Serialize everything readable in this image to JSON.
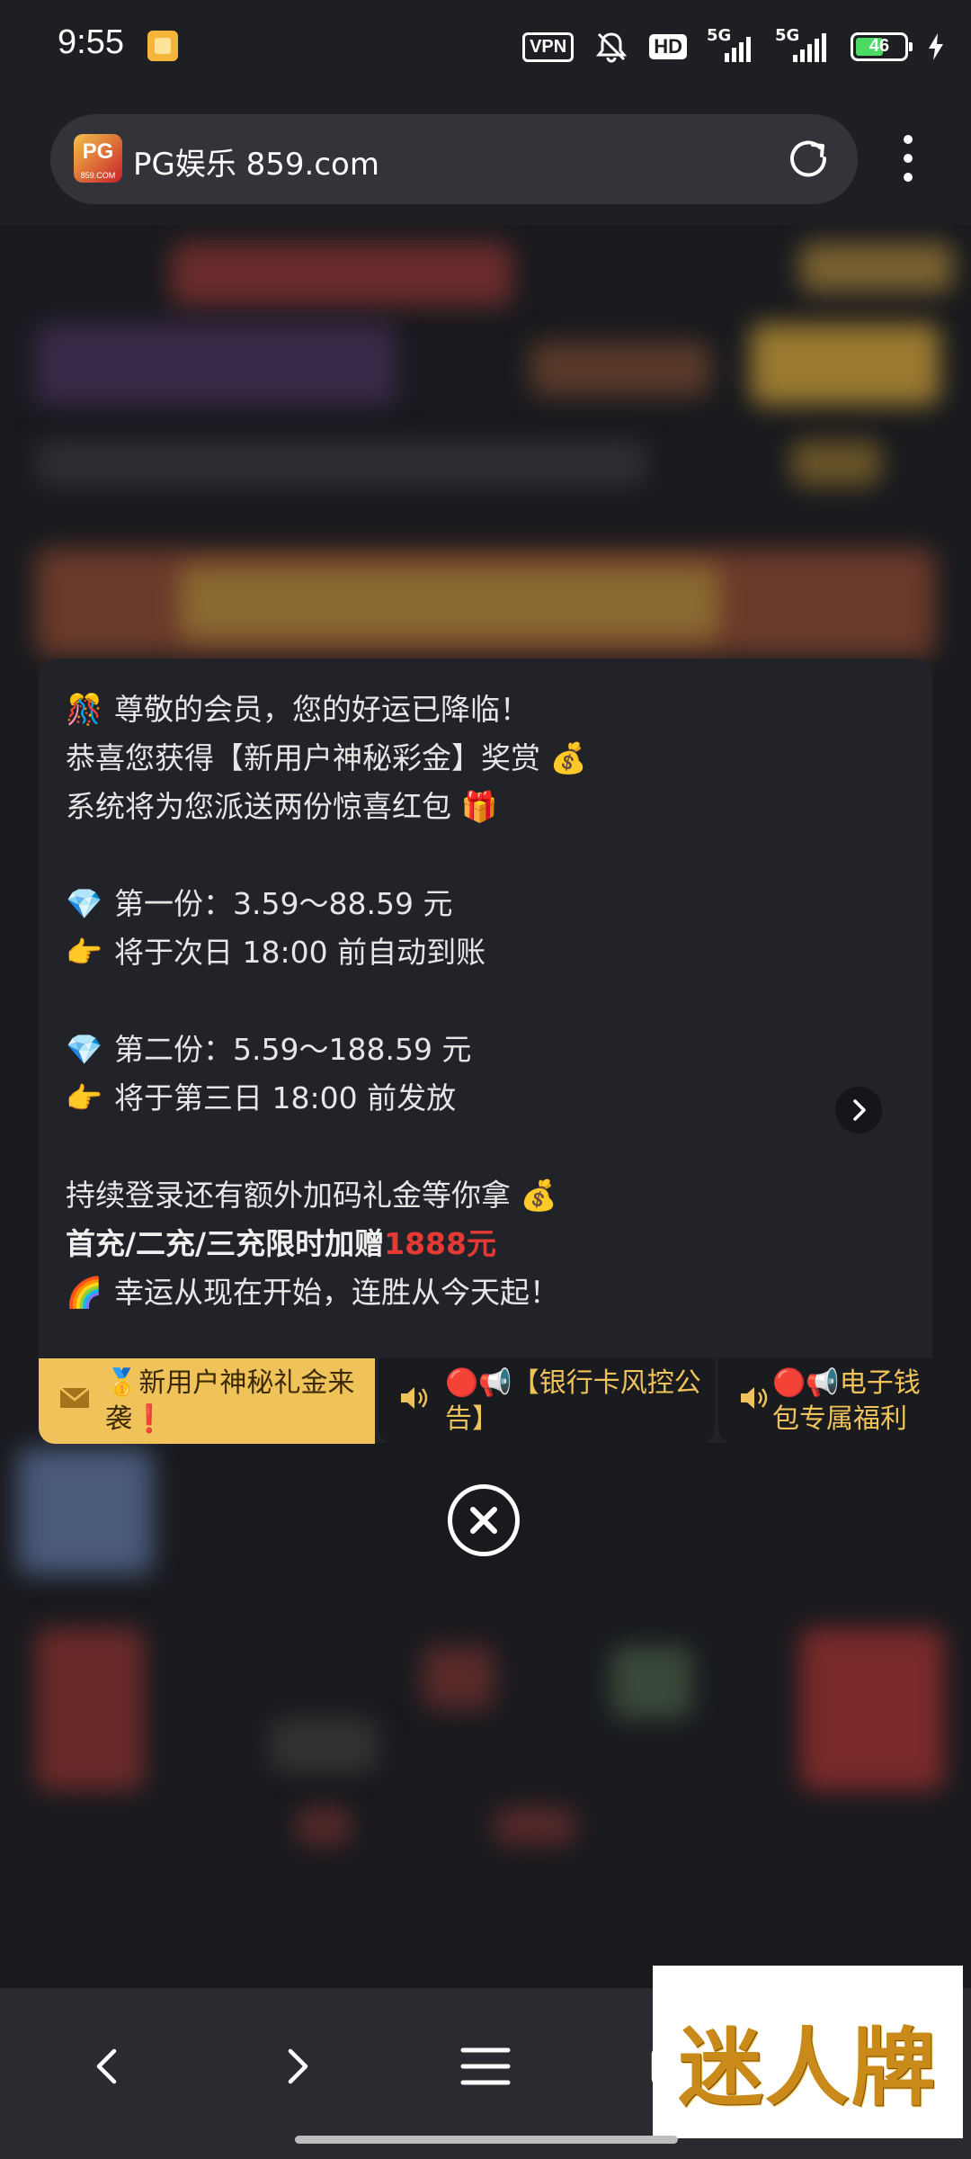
{
  "status_bar": {
    "time": "9:55",
    "vpn_label": "VPN",
    "hd_label": "HD",
    "network_1": "5G",
    "network_2": "5G",
    "battery": "46"
  },
  "browser": {
    "favicon_text": "PG",
    "favicon_domain": "859.COM",
    "url_title": "PG娱乐 859.com"
  },
  "popup": {
    "lines": [
      {
        "emoji": "🎊",
        "text": "尊敬的会员，您的好运已降临！"
      },
      {
        "emoji": "",
        "text": "恭喜您获得【新用户神秘彩金】奖赏 💰"
      },
      {
        "emoji": "",
        "text": "系统将为您派送两份惊喜红包 🎁"
      },
      {
        "emoji": "💎",
        "text": "第一份：3.59～88.59 元"
      },
      {
        "emoji": "👉",
        "text": "将于次日 18:00 前自动到账"
      },
      {
        "emoji": "💎",
        "text": "第二份：5.59～188.59 元"
      },
      {
        "emoji": "👉",
        "text": "将于第三日 18:00 前发放"
      },
      {
        "emoji": "",
        "text": "持续登录还有额外加码礼金等你拿 💰"
      },
      {
        "emoji": "",
        "text": "首充/二充/三充限时加赠",
        "highlight": "1888元"
      },
      {
        "emoji": "🌈",
        "text": "幸运从现在开始，连胜从今天起！"
      }
    ],
    "tabs": [
      {
        "icon": "envelope-icon",
        "label": "🥇新用户神秘礼金来袭❗"
      },
      {
        "icon": "speaker-icon",
        "label": "🔴📢【银行卡风控公告】"
      },
      {
        "icon": "speaker-icon",
        "label": "🔴📢电子钱包专属福利"
      }
    ]
  },
  "watermark": "迷人牌",
  "colors": {
    "accent_gold": "#f0c35a",
    "highlight_red": "#e53935",
    "popup_bg": "#222328"
  }
}
